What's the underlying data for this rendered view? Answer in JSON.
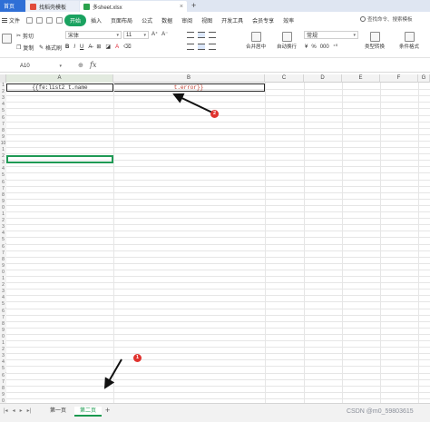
{
  "tabs": {
    "home": "首页",
    "template": "找稻壳模板",
    "file": "多sheet.xlsx",
    "new_tab": "+"
  },
  "menu": {
    "file": "文件",
    "items": [
      "开始",
      "插入",
      "页面布局",
      "公式",
      "数据",
      "审阅",
      "视图",
      "开发工具",
      "会员专享",
      "效率"
    ],
    "active_index": 0,
    "search": "查找命令、搜索模板"
  },
  "ribbon": {
    "cut": "剪切",
    "copy": "复制",
    "format_painter": "格式刷",
    "font": "宋体",
    "size": "11",
    "merge_center": "合并居中",
    "wrap": "自动换行",
    "number_format": "常规",
    "type_convert": "类型转换",
    "conditional_format": "条件格式",
    "accent": "#1aa260"
  },
  "formula_bar": {
    "cell_ref": "A10",
    "fx": "fx"
  },
  "sheet": {
    "columns": [
      "A",
      "B",
      "C",
      "D",
      "E",
      "F",
      "G"
    ],
    "row_numbers": [
      "1",
      "2",
      "3",
      "4",
      "5",
      "6",
      "7",
      "8",
      "9",
      "10",
      "1",
      "2",
      "3",
      "4",
      "5",
      "6",
      "7",
      "8",
      "9",
      "0",
      "1",
      "2",
      "3",
      "4",
      "5",
      "6",
      "7",
      "8",
      "9",
      "0",
      "1",
      "2",
      "3",
      "4",
      "5",
      "6",
      "7",
      "8",
      "9",
      "0",
      "1",
      "2",
      "3",
      "4",
      "5",
      "6",
      "7",
      "8",
      "9",
      "0"
    ],
    "cell_a1": "{{fe:list2 t.name",
    "cell_b1": "t.error}}"
  },
  "sheet_tabs": {
    "sheet1": "第一页",
    "sheet2": "第二页",
    "add": "+"
  },
  "annotations": {
    "badge1": "1",
    "badge2": "2"
  },
  "watermark": "CSDN @m0_59803615"
}
